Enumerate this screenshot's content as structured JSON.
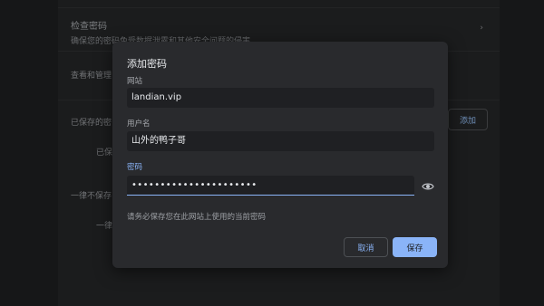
{
  "background": {
    "check_passwords": {
      "title": "检查密码",
      "desc": "确保您的密码免受数据泄露和其他安全问题的侵害"
    },
    "view_manage": "查看和管理",
    "saved_passwords": "已保存的密",
    "saved_item": "已保",
    "add_button": "添加",
    "never_saved": "一律不保存",
    "never_item": "一律"
  },
  "dialog": {
    "title": "添加密码",
    "site_label": "网站",
    "site_value": "landian.vip",
    "user_label": "用户名",
    "user_value": "山外的鸭子哥",
    "password_label": "密码",
    "password_value": "••••••••••••••••••••••",
    "note": "请务必保存您在此网站上使用的当前密码",
    "cancel_label": "取消",
    "save_label": "保存",
    "eye_icon": "eye-icon"
  },
  "colors": {
    "accent": "#8ab4f8",
    "dialog_bg": "#292a2d",
    "field_bg": "#1f2023"
  }
}
